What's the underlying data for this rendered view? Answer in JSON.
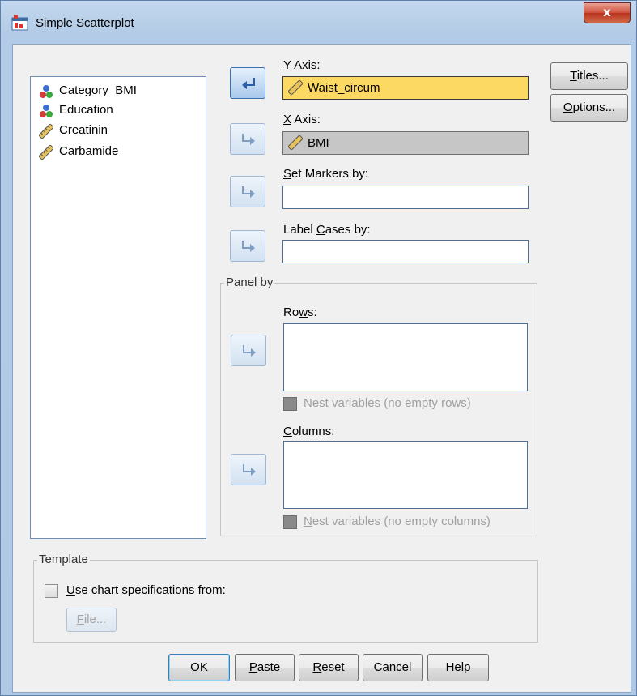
{
  "window": {
    "title": "Simple Scatterplot",
    "close_label": "x"
  },
  "variables": [
    {
      "name": "Category_BMI",
      "icon": "nominal-icon"
    },
    {
      "name": "Education",
      "icon": "nominal-icon"
    },
    {
      "name": "Creatinin",
      "icon": "scale-ruler-icon"
    },
    {
      "name": "Carbamide",
      "icon": "scale-ruler-icon"
    }
  ],
  "y_axis": {
    "label_u": "Y",
    "label_rest": " Axis:",
    "value": "Waist_circum"
  },
  "x_axis": {
    "label_u": "X",
    "label_rest": " Axis:",
    "value": "BMI"
  },
  "set_markers": {
    "label_u": "S",
    "label_rest": "et Markers by:",
    "value": ""
  },
  "label_cases": {
    "label_pre": "Label ",
    "label_u": "C",
    "label_rest": "ases by:",
    "value": ""
  },
  "panel_by": {
    "title": "Panel by",
    "rows_label_pre": "Ro",
    "rows_label_u": "w",
    "rows_label_rest": "s:",
    "nest_rows_u": "N",
    "nest_rows_rest": "est variables (no empty rows)",
    "columns_label_u": "C",
    "columns_label_rest": "olumns:",
    "nest_cols_u": "N",
    "nest_cols_rest": "est variables (no empty columns)"
  },
  "template": {
    "title": "Template",
    "use_spec_u": "U",
    "use_spec_rest": "se chart specifications from:",
    "file_u": "F",
    "file_rest": "ile..."
  },
  "side_buttons": {
    "titles_u": "T",
    "titles_rest": "itles...",
    "options_u": "O",
    "options_rest": "ptions..."
  },
  "bottom_buttons": {
    "ok": "OK",
    "paste_u": "P",
    "paste_rest": "aste",
    "reset_u": "R",
    "reset_rest": "eset",
    "cancel": "Cancel",
    "help": "Help"
  }
}
